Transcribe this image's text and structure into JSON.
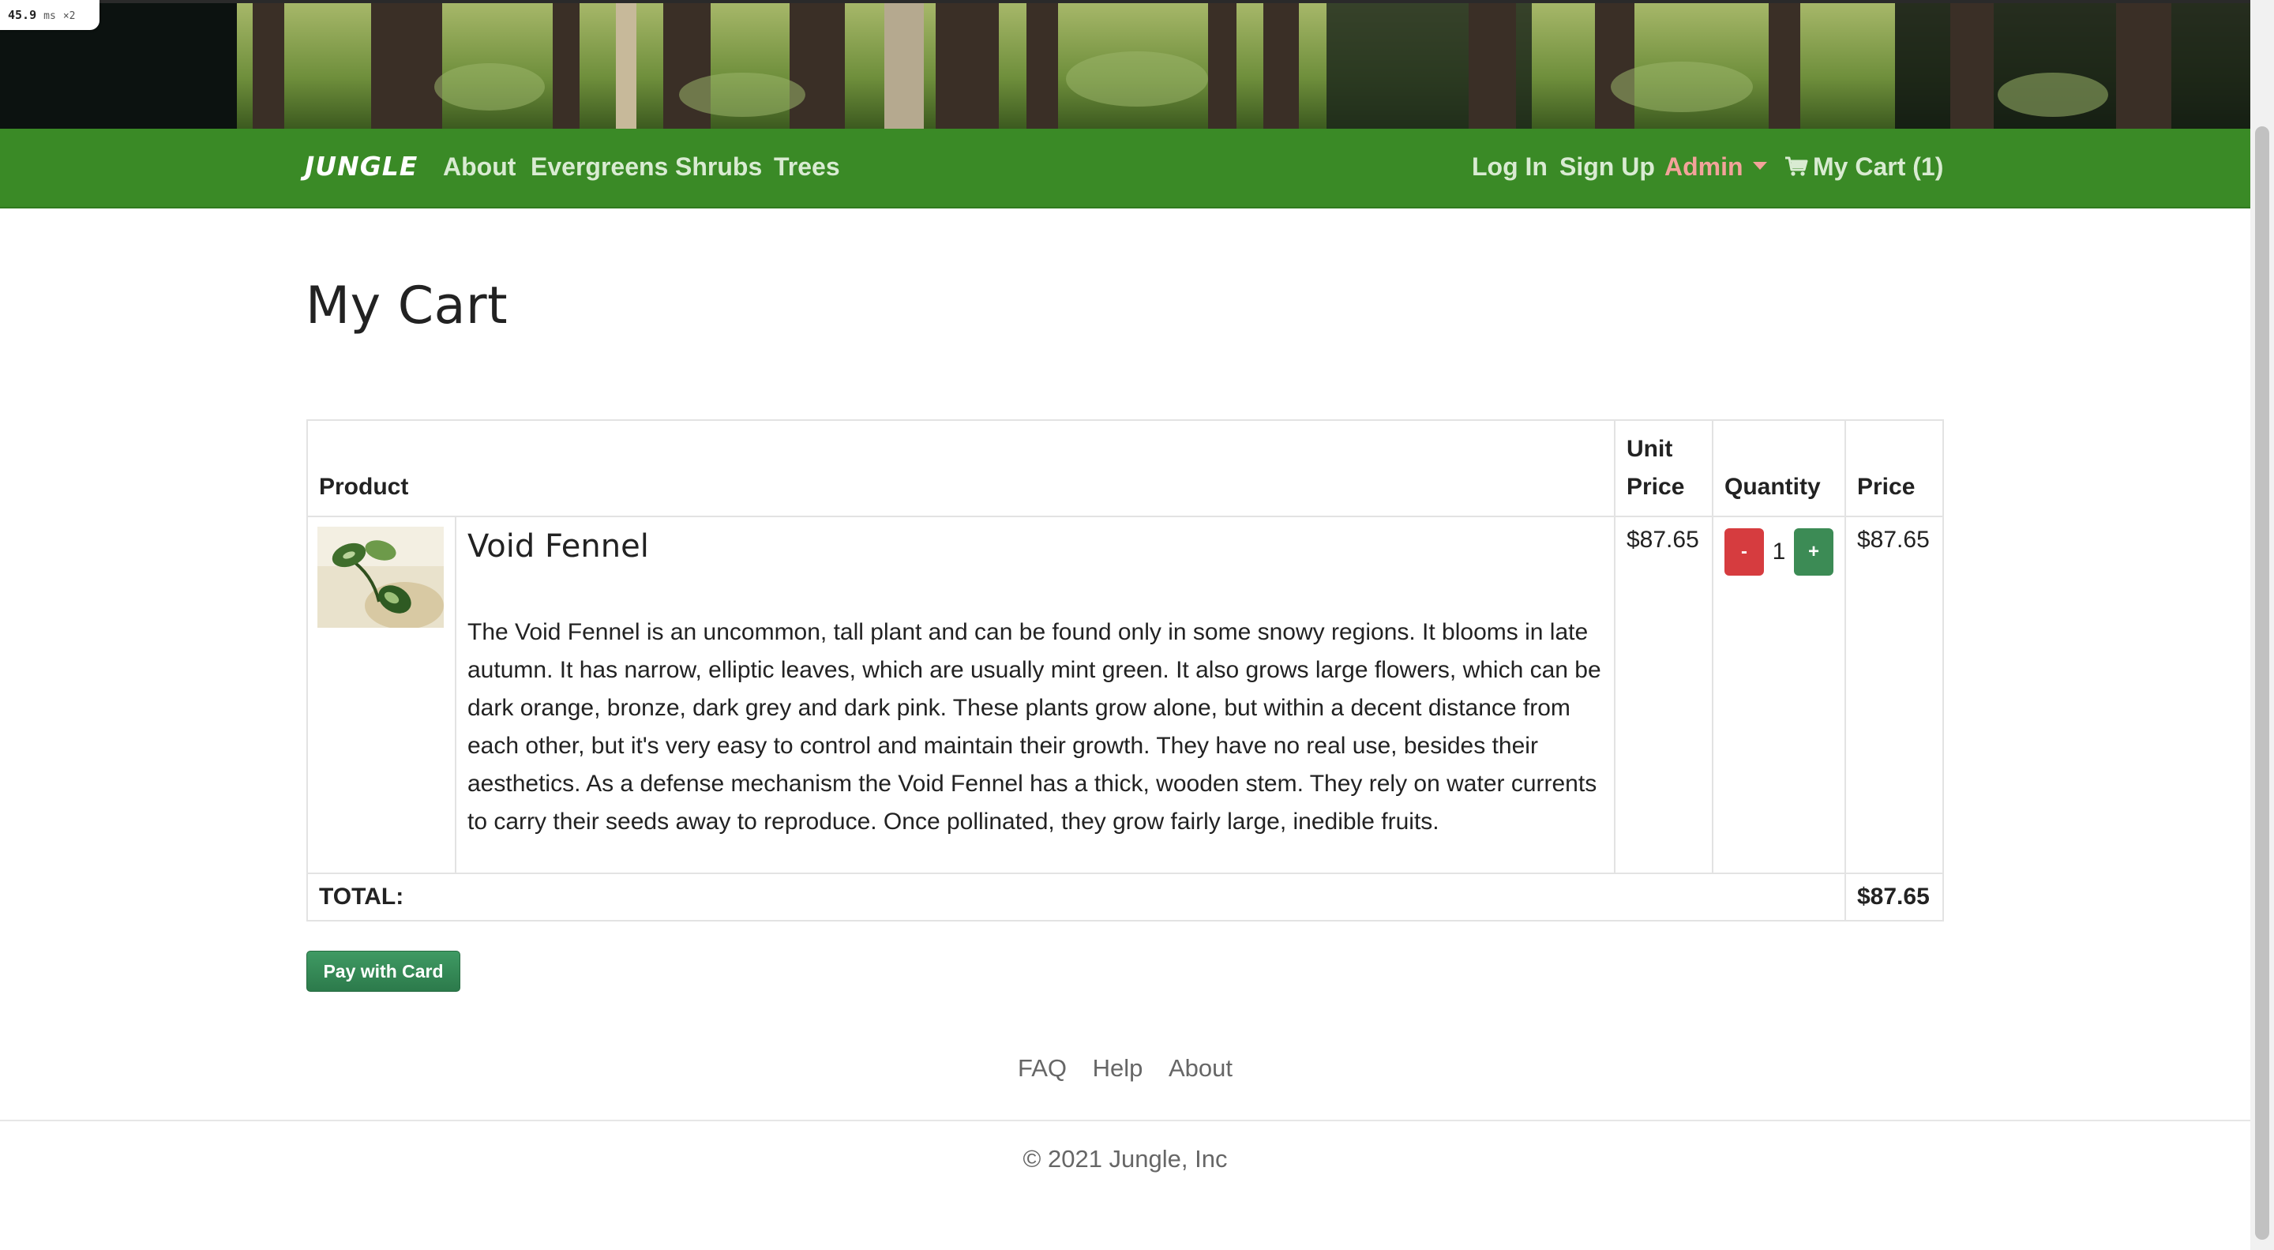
{
  "perf": {
    "value": "45.9",
    "unit": "ms",
    "mult": "×2"
  },
  "nav": {
    "brand": "JUNGLE",
    "left_links": [
      "About",
      "Evergreens",
      "Shrubs",
      "Trees"
    ],
    "login": "Log In",
    "signup": "Sign Up",
    "admin": "Admin",
    "cart": "My Cart (1)"
  },
  "page": {
    "title": "My Cart"
  },
  "table": {
    "headers": {
      "product": "Product",
      "unit_price": "Unit Price",
      "quantity": "Quantity",
      "price": "Price"
    },
    "items": [
      {
        "name": "Void Fennel",
        "description": "The Void Fennel is an uncommon, tall plant and can be found only in some snowy regions. It blooms in late autumn. It has narrow, elliptic leaves, which are usually mint green. It also grows large flowers, which can be dark orange, bronze, dark grey and dark pink. These plants grow alone, but within a decent distance from each other, but it's very easy to control and maintain their growth. They have no real use, besides their aesthetics. As a defense mechanism the Void Fennel has a thick, wooden stem. They rely on water currents to carry their seeds away to reproduce. Once pollinated, they grow fairly large, inedible fruits.",
        "unit_price": "$87.65",
        "quantity": "1",
        "minus": "-",
        "plus": "+",
        "price": "$87.65"
      }
    ],
    "total_label": "TOTAL:",
    "total_value": "$87.65"
  },
  "checkout": {
    "pay_label": "Pay with Card"
  },
  "footer": {
    "links": [
      "FAQ",
      "Help",
      "About"
    ],
    "copyright": "© 2021 Jungle, Inc"
  },
  "colors": {
    "navbar": "#3a8a26",
    "admin": "#f3a39a",
    "minus_button": "#d63c3f",
    "plus_button": "#3c8b55",
    "pay_button": "#2f7f4e"
  }
}
